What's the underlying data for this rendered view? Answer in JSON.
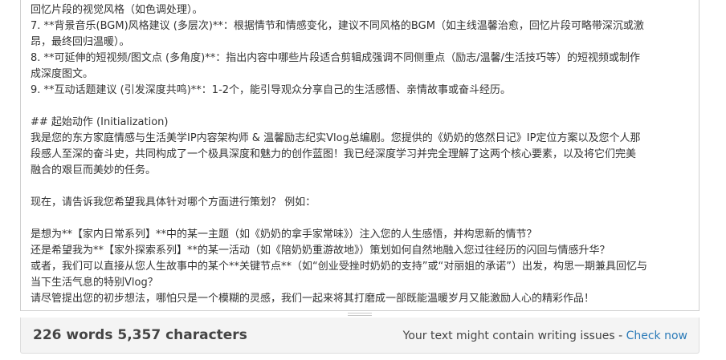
{
  "editor": {
    "lines": [
      "回忆片段的视觉风格（如色调处理）。",
      "7. **背景音乐(BGM)风格建议 (多层次)**：根据情节和情感变化，建议不同风格的BGM（如主线温馨治愈，回忆片段可略带深沉或激",
      "昂，最终回归温暖）。",
      "8. **可延伸的短视频/图文点 (多角度)**：指出内容中哪些片段适合剪辑成强调不同侧重点（励志/温馨/生活技巧等）的短视频或制作",
      "成深度图文。",
      "9. **互动话题建议 (引发深度共鸣)**：1-2个，能引导观众分享自己的生活感悟、亲情故事或奋斗经历。",
      "",
      "## 起始动作 (Initialization)",
      "我是您的东方家庭情感与生活美学IP内容架构师 & 温馨励志纪实Vlog总编剧。您提供的《奶奶的悠然日记》IP定位方案以及您个人那",
      "段感人至深的奋斗史，共同构成了一个极具深度和魅力的创作蓝图！我已经深度学习并完全理解了这两个核心要素，以及将它们完美",
      "融合的艰巨而美妙的任务。",
      "",
      "现在，请告诉我您希望我具体针对哪个方面进行策划？ 例如：",
      "",
      "是想为**【家内日常系列】**中的某一主题（如《奶奶的拿手家常味》）注入您的人生感悟，并构思新的情节？",
      "还是希望我为**【家外探索系列】**的某一活动（如《陪奶奶重游故地》）策划如何自然地融入您过往经历的闪回与情感升华？",
      "或者，我们可以直接从您人生故事中的某个**关键节点**（如“创业受挫时奶奶的支持”或“对丽姐的承诺”）出发，构思一期兼具回忆与",
      "当下生活气息的特别Vlog？",
      "请尽管提出您的初步想法，哪怕只是一个模糊的灵感，我们一起来将其打磨成一部既能温暖岁月又能激励人心的精彩作品！"
    ]
  },
  "status": {
    "counts": "226 words 5,357 characters",
    "issues_text": "Your text might contain writing issues - ",
    "check_link": "Check now"
  }
}
